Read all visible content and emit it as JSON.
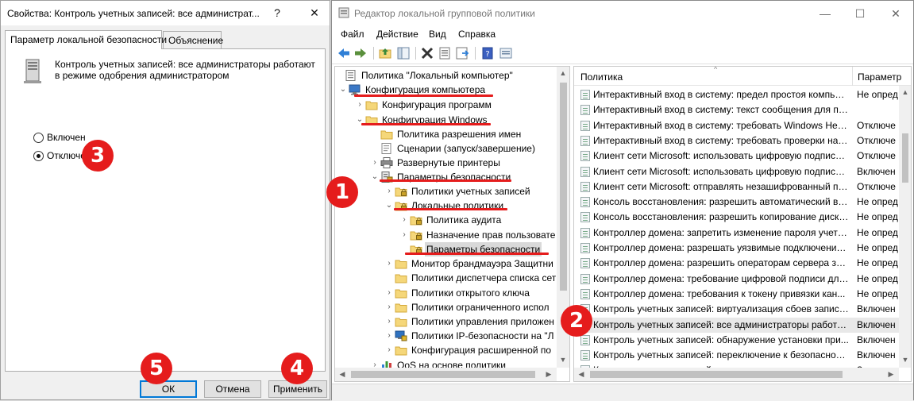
{
  "dialog": {
    "title": "Свойства: Контроль учетных записей: все администрат...",
    "help_glyph": "?",
    "close_glyph": "✕",
    "tabs": [
      {
        "label": "Параметр локальной безопасности",
        "active": true
      },
      {
        "label": "Объяснение",
        "active": false
      }
    ],
    "policy_text": "Контроль учетных записей: все администраторы работают в режиме одобрения администратором",
    "radios": [
      {
        "label": "Включен",
        "checked": false
      },
      {
        "label": "Отключен",
        "checked": true
      }
    ],
    "buttons": {
      "ok": "ОК",
      "cancel": "Отмена",
      "apply": "Применить"
    }
  },
  "gpedit": {
    "title": "Редактор локальной групповой политики",
    "window_controls": {
      "minimize": "—",
      "maximize": "☐",
      "close": "✕"
    },
    "menu": [
      "Файл",
      "Действие",
      "Вид",
      "Справка"
    ],
    "tree": [
      {
        "label": "Политика \"Локальный компьютер\"",
        "expander": "",
        "icon": "computer-policy-icon"
      },
      {
        "label": "Конфигурация компьютера",
        "expander": "⌄",
        "icon": "computer-icon"
      },
      {
        "label": "Конфигурация программ",
        "expander": "›",
        "icon": "folder-icon"
      },
      {
        "label": "Конфигурация Windows",
        "expander": "⌄",
        "icon": "folder-icon"
      },
      {
        "label": "Политика разрешения имен",
        "expander": "",
        "icon": "folder-icon"
      },
      {
        "label": "Сценарии (запуск/завершение)",
        "expander": "",
        "icon": "script-icon"
      },
      {
        "label": "Развернутые принтеры",
        "expander": "›",
        "icon": "printer-icon"
      },
      {
        "label": "Параметры безопасности",
        "expander": "⌄",
        "icon": "security-settings-icon"
      },
      {
        "label": "Политики учетных записей",
        "expander": "›",
        "icon": "folder-lock-icon"
      },
      {
        "label": "Локальные политики",
        "expander": "⌄",
        "icon": "folder-lock-icon"
      },
      {
        "label": "Политика аудита",
        "expander": "›",
        "icon": "folder-lock-icon"
      },
      {
        "label": "Назначение прав пользовате",
        "expander": "›",
        "icon": "folder-lock-icon"
      },
      {
        "label": "Параметры безопасности",
        "expander": "",
        "icon": "folder-lock-icon",
        "selected": true
      },
      {
        "label": "Монитор брандмауэра Защитни",
        "expander": "›",
        "icon": "folder-icon"
      },
      {
        "label": "Политики диспетчера списка сет",
        "expander": "",
        "icon": "folder-icon"
      },
      {
        "label": "Политики открытого ключа",
        "expander": "›",
        "icon": "folder-icon"
      },
      {
        "label": "Политики ограниченного испол",
        "expander": "›",
        "icon": "folder-icon"
      },
      {
        "label": "Политики управления приложен",
        "expander": "›",
        "icon": "folder-icon"
      },
      {
        "label": "Политики IP-безопасности на \"Л",
        "expander": "›",
        "icon": "ipsec-icon"
      },
      {
        "label": "Конфигурация расширенной по",
        "expander": "›",
        "icon": "folder-icon"
      },
      {
        "label": "QoS на основе политики",
        "expander": "›",
        "icon": "qos-chart-icon"
      }
    ],
    "list_headers": {
      "policy": "Политика",
      "setting": "Параметр"
    },
    "list_rows": [
      {
        "policy": "Интерактивный вход в систему: предел простоя компью...",
        "setting": "Не опред"
      },
      {
        "policy": "Интерактивный вход в систему: текст сообщения для по...",
        "setting": ""
      },
      {
        "policy": "Интерактивный вход в систему: требовать Windows Hello...",
        "setting": "Отключе"
      },
      {
        "policy": "Интерактивный вход в систему: требовать проверки на к...",
        "setting": "Отключе"
      },
      {
        "policy": "Клиент сети Microsoft: использовать цифровую подпись ...",
        "setting": "Отключе"
      },
      {
        "policy": "Клиент сети Microsoft: использовать цифровую подпись ...",
        "setting": "Включен"
      },
      {
        "policy": "Клиент сети Microsoft: отправлять незашифрованный па...",
        "setting": "Отключе"
      },
      {
        "policy": "Консоль восстановления: разрешить автоматический вх...",
        "setting": "Не опред"
      },
      {
        "policy": "Консоль восстановления: разрешить копирование диске...",
        "setting": "Не опред"
      },
      {
        "policy": "Контроллер домена: запретить изменение пароля учетн...",
        "setting": "Не опред"
      },
      {
        "policy": "Контроллер домена: разрешать уязвимые подключения ...",
        "setting": "Не опред"
      },
      {
        "policy": "Контроллер домена: разрешить операторам сервера зад...",
        "setting": "Не опред"
      },
      {
        "policy": "Контроллер домена: требование цифровой подписи для ...",
        "setting": "Не опред"
      },
      {
        "policy": "Контроллер домена: требования к токену привязки кан...",
        "setting": "Не опред"
      },
      {
        "policy": "Контроль учетных записей: виртуализация сбоев записи ...",
        "setting": "Включен"
      },
      {
        "policy": "Контроль учетных записей: все администраторы работа...",
        "setting": "Включен",
        "highlight": true
      },
      {
        "policy": "Контроль учетных записей: обнаружение установки при...",
        "setting": "Включен"
      },
      {
        "policy": "Контроль учетных записей: переключение к безопасном...",
        "setting": "Включен"
      },
      {
        "policy": "Контроль учетных записей: поведение запроса на повы...",
        "setting": "Запрос с"
      }
    ]
  },
  "annotations": [
    "1",
    "2",
    "3",
    "4",
    "5"
  ],
  "colors": {
    "annotation_red": "#e51c1c",
    "selection_gray": "#d9d9d9",
    "default_button_blue": "#0078d7"
  }
}
